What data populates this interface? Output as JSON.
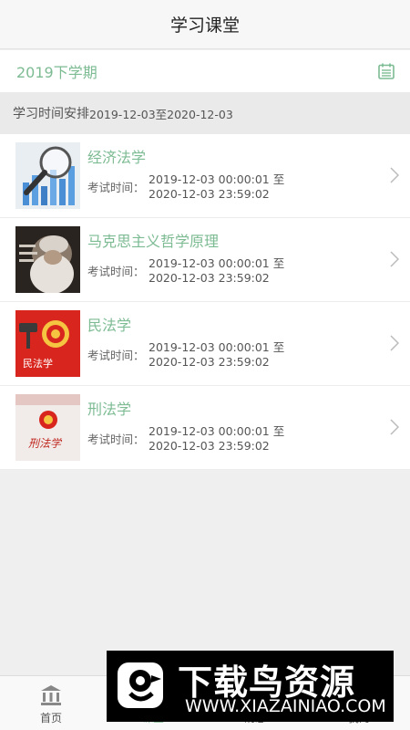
{
  "header": {
    "title": "学习课堂"
  },
  "term": {
    "label": "2019下学期",
    "icon": "calendar-icon"
  },
  "schedule": {
    "label": "学习时间安排",
    "range": "2019-12-03至2020-12-03"
  },
  "exam_label": "考试时间：",
  "courses": [
    {
      "title": "经济法学",
      "start": "2019-12-03 00:00:01 至",
      "end": "2020-12-03 23:59:02"
    },
    {
      "title": "马克思主义哲学原理",
      "start": "2019-12-03 00:00:01 至",
      "end": "2020-12-03 23:59:02"
    },
    {
      "title": "民法学",
      "start": "2019-12-03 00:00:01 至",
      "end": "2020-12-03 23:59:02",
      "thumb_text": "民法学"
    },
    {
      "title": "刑法学",
      "start": "2019-12-03 00:00:01 至",
      "end": "2020-12-03 23:59:02",
      "thumb_text": "刑法学"
    }
  ],
  "tabs": [
    {
      "label": "首页",
      "icon": "home-icon"
    },
    {
      "label": "课堂",
      "icon": "classroom-icon"
    },
    {
      "label": "消息",
      "icon": "message-icon"
    },
    {
      "label": "我的",
      "icon": "profile-icon"
    }
  ],
  "watermark": {
    "title": "下载鸟资源",
    "url": "WWW.XIAZAINIAO.COM"
  },
  "colors": {
    "accent": "#7dbb93",
    "background": "#efefef",
    "watermark_bg": "#000000"
  }
}
